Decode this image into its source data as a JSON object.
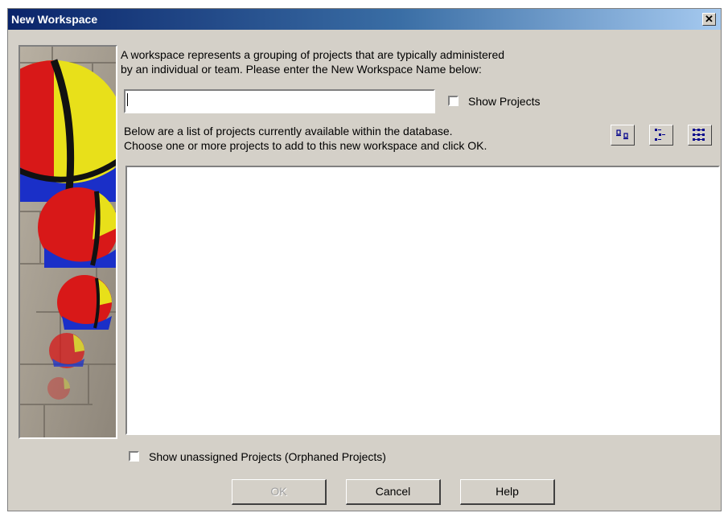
{
  "window": {
    "title": "New Workspace",
    "close_glyph": "✕"
  },
  "intro": {
    "line1": "A workspace represents a grouping of projects that are typically administered",
    "line2": "by an individual or team. Please enter the New Workspace Name below:"
  },
  "name_input": {
    "value": "",
    "placeholder": ""
  },
  "show_projects": {
    "label": "Show Projects",
    "checked": false
  },
  "list_intro": {
    "line1": "Below are a list of projects currently available within the database.",
    "line2": "Choose one or more projects to add to this new workspace and click OK."
  },
  "toolbar": {
    "icons": [
      "view-list-icon",
      "view-tree-icon",
      "view-details-icon"
    ]
  },
  "projects": [],
  "orphaned": {
    "label": "Show unassigned Projects (Orphaned Projects)",
    "checked": false
  },
  "buttons": {
    "ok": "OK",
    "cancel": "Cancel",
    "help": "Help"
  },
  "colors": {
    "titlebar_start": "#0a246a",
    "titlebar_end": "#a6caf0",
    "face": "#d4d0c8"
  }
}
